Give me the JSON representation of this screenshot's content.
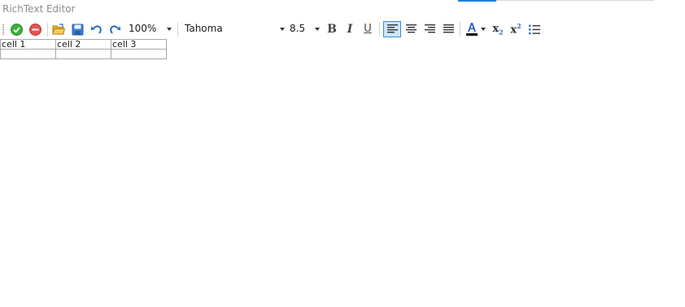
{
  "window": {
    "title": "RichText Editor"
  },
  "toolbar": {
    "accept_icon": "check-circle-icon",
    "cancel_icon": "stop-circle-icon",
    "zoom": "100%",
    "font_family": "Tahoma",
    "font_size": "8.5",
    "bold": "B",
    "italic": "I",
    "underline": "U",
    "alignment_active": "left",
    "accent_color": "#3c8bd1",
    "subscript": "x",
    "superscript": "x"
  },
  "document": {
    "table": {
      "rows": [
        [
          "cell 1",
          "cell 2",
          "cell 3"
        ],
        [
          "",
          "",
          ""
        ]
      ]
    }
  }
}
